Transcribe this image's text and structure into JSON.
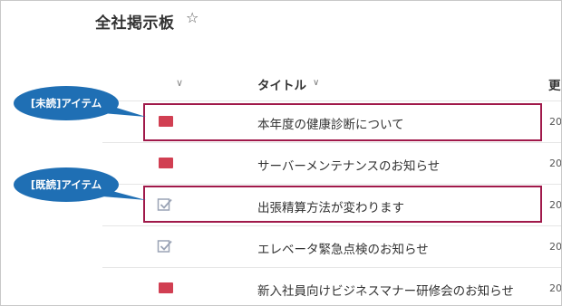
{
  "page": {
    "title": "全社掲示板",
    "star_icon": "☆"
  },
  "columns": {
    "select_chevron": "∨",
    "title_header": "タイトル",
    "title_chevron": "∨",
    "next_header_partial": "更"
  },
  "items": [
    {
      "title": "本年度の健康診断について",
      "date_partial": "20",
      "status": "unread"
    },
    {
      "title": "サーバーメンテナンスのお知らせ",
      "date_partial": "20",
      "status": "unread"
    },
    {
      "title": "出張精算方法が変わります",
      "date_partial": "20",
      "status": "read"
    },
    {
      "title": "エレベータ緊急点検のお知らせ",
      "date_partial": "20",
      "status": "read"
    },
    {
      "title": "新入社員向けビジネスマナー研修会のお知らせ",
      "date_partial": "20",
      "status": "unread"
    }
  ],
  "callouts": {
    "unread_label": "[未読]アイテム",
    "read_label": "[既読]アイテム"
  },
  "colors": {
    "unread_icon": "#d13f52",
    "highlight_border": "#a0194a",
    "callout_bg": "#1f6fb4"
  }
}
